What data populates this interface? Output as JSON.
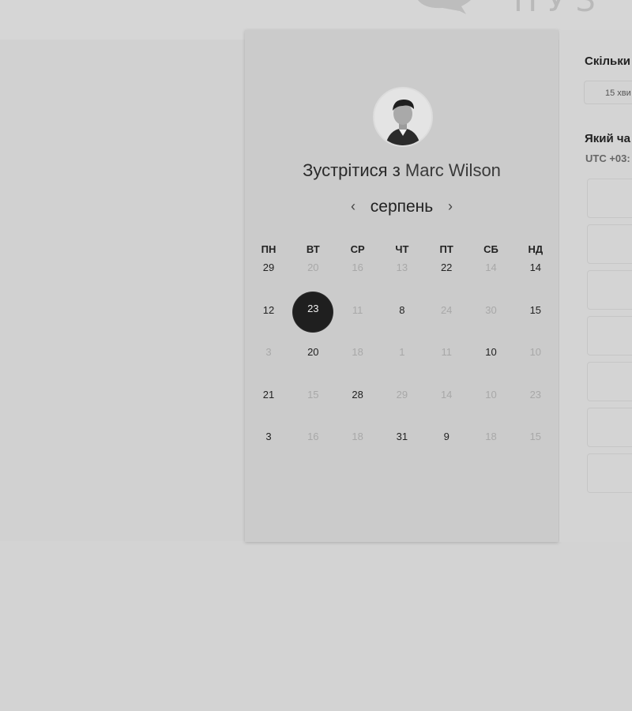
{
  "host": {
    "title_prefix": "Зустрітися з",
    "name": "Marc Wilson"
  },
  "calendar": {
    "month": "серпень",
    "prev_icon": "chevron-left-icon",
    "next_icon": "chevron-right-icon",
    "weekdays": [
      "ПН",
      "ВТ",
      "СР",
      "ЧТ",
      "ПТ",
      "СБ",
      "НД"
    ],
    "selected_day": "23",
    "weeks": [
      [
        {
          "d": "29",
          "available": true
        },
        {
          "d": "20",
          "available": false
        },
        {
          "d": "16",
          "available": false
        },
        {
          "d": "13",
          "available": false
        },
        {
          "d": "22",
          "available": true
        },
        {
          "d": "14",
          "available": false
        },
        {
          "d": "14",
          "available": true
        }
      ],
      [
        {
          "d": "12",
          "available": true
        },
        {
          "d": "23",
          "available": true,
          "selected": true
        },
        {
          "d": "11",
          "available": false
        },
        {
          "d": "8",
          "available": true
        },
        {
          "d": "24",
          "available": false
        },
        {
          "d": "30",
          "available": false
        },
        {
          "d": "15",
          "available": true
        }
      ],
      [
        {
          "d": "3",
          "available": false
        },
        {
          "d": "20",
          "available": true
        },
        {
          "d": "18",
          "available": false
        },
        {
          "d": "1",
          "available": false
        },
        {
          "d": "11",
          "available": false
        },
        {
          "d": "10",
          "available": true
        },
        {
          "d": "10",
          "available": false
        }
      ],
      [
        {
          "d": "21",
          "available": true
        },
        {
          "d": "15",
          "available": false
        },
        {
          "d": "28",
          "available": true
        },
        {
          "d": "29",
          "available": false
        },
        {
          "d": "14",
          "available": false
        },
        {
          "d": "10",
          "available": false
        },
        {
          "d": "23",
          "available": false
        }
      ],
      [
        {
          "d": "3",
          "available": true
        },
        {
          "d": "16",
          "available": false
        },
        {
          "d": "18",
          "available": false
        },
        {
          "d": "31",
          "available": true
        },
        {
          "d": "9",
          "available": true
        },
        {
          "d": "18",
          "available": false
        },
        {
          "d": "15",
          "available": false
        }
      ]
    ]
  },
  "booking": {
    "duration_label": "Скільки",
    "duration_value": "15 хви",
    "time_label": "Який ча",
    "timezone": "UTC +03:",
    "slot_count": 7
  },
  "colors": {
    "background": "#d3d3d3",
    "card": "#cbcbcb",
    "selected_day": "#1f1f1f",
    "unavailable_text": "#a8a8a8"
  }
}
